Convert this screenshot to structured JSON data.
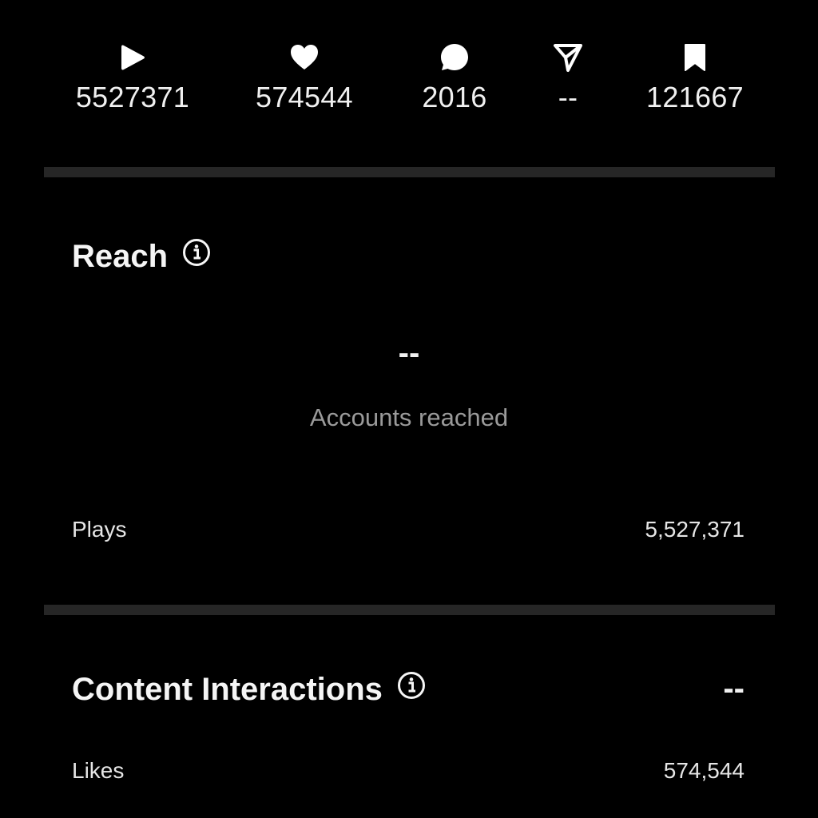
{
  "stats": [
    {
      "icon": "play-icon",
      "value": "5527371"
    },
    {
      "icon": "heart-icon",
      "value": "574544"
    },
    {
      "icon": "comment-icon",
      "value": "2016"
    },
    {
      "icon": "send-icon",
      "value": "--"
    },
    {
      "icon": "bookmark-icon",
      "value": "121667"
    }
  ],
  "reach": {
    "title": "Reach",
    "value": "--",
    "label": "Accounts reached",
    "rows": [
      {
        "label": "Plays",
        "value": "5,527,371"
      }
    ]
  },
  "content_interactions": {
    "title": "Content Interactions",
    "value": "--",
    "rows": [
      {
        "label": "Likes",
        "value": "574,544"
      }
    ]
  },
  "colors": {
    "background": "#000000",
    "divider": "#262626",
    "text": "#f2f2f2",
    "muted": "#9a9a9a"
  }
}
